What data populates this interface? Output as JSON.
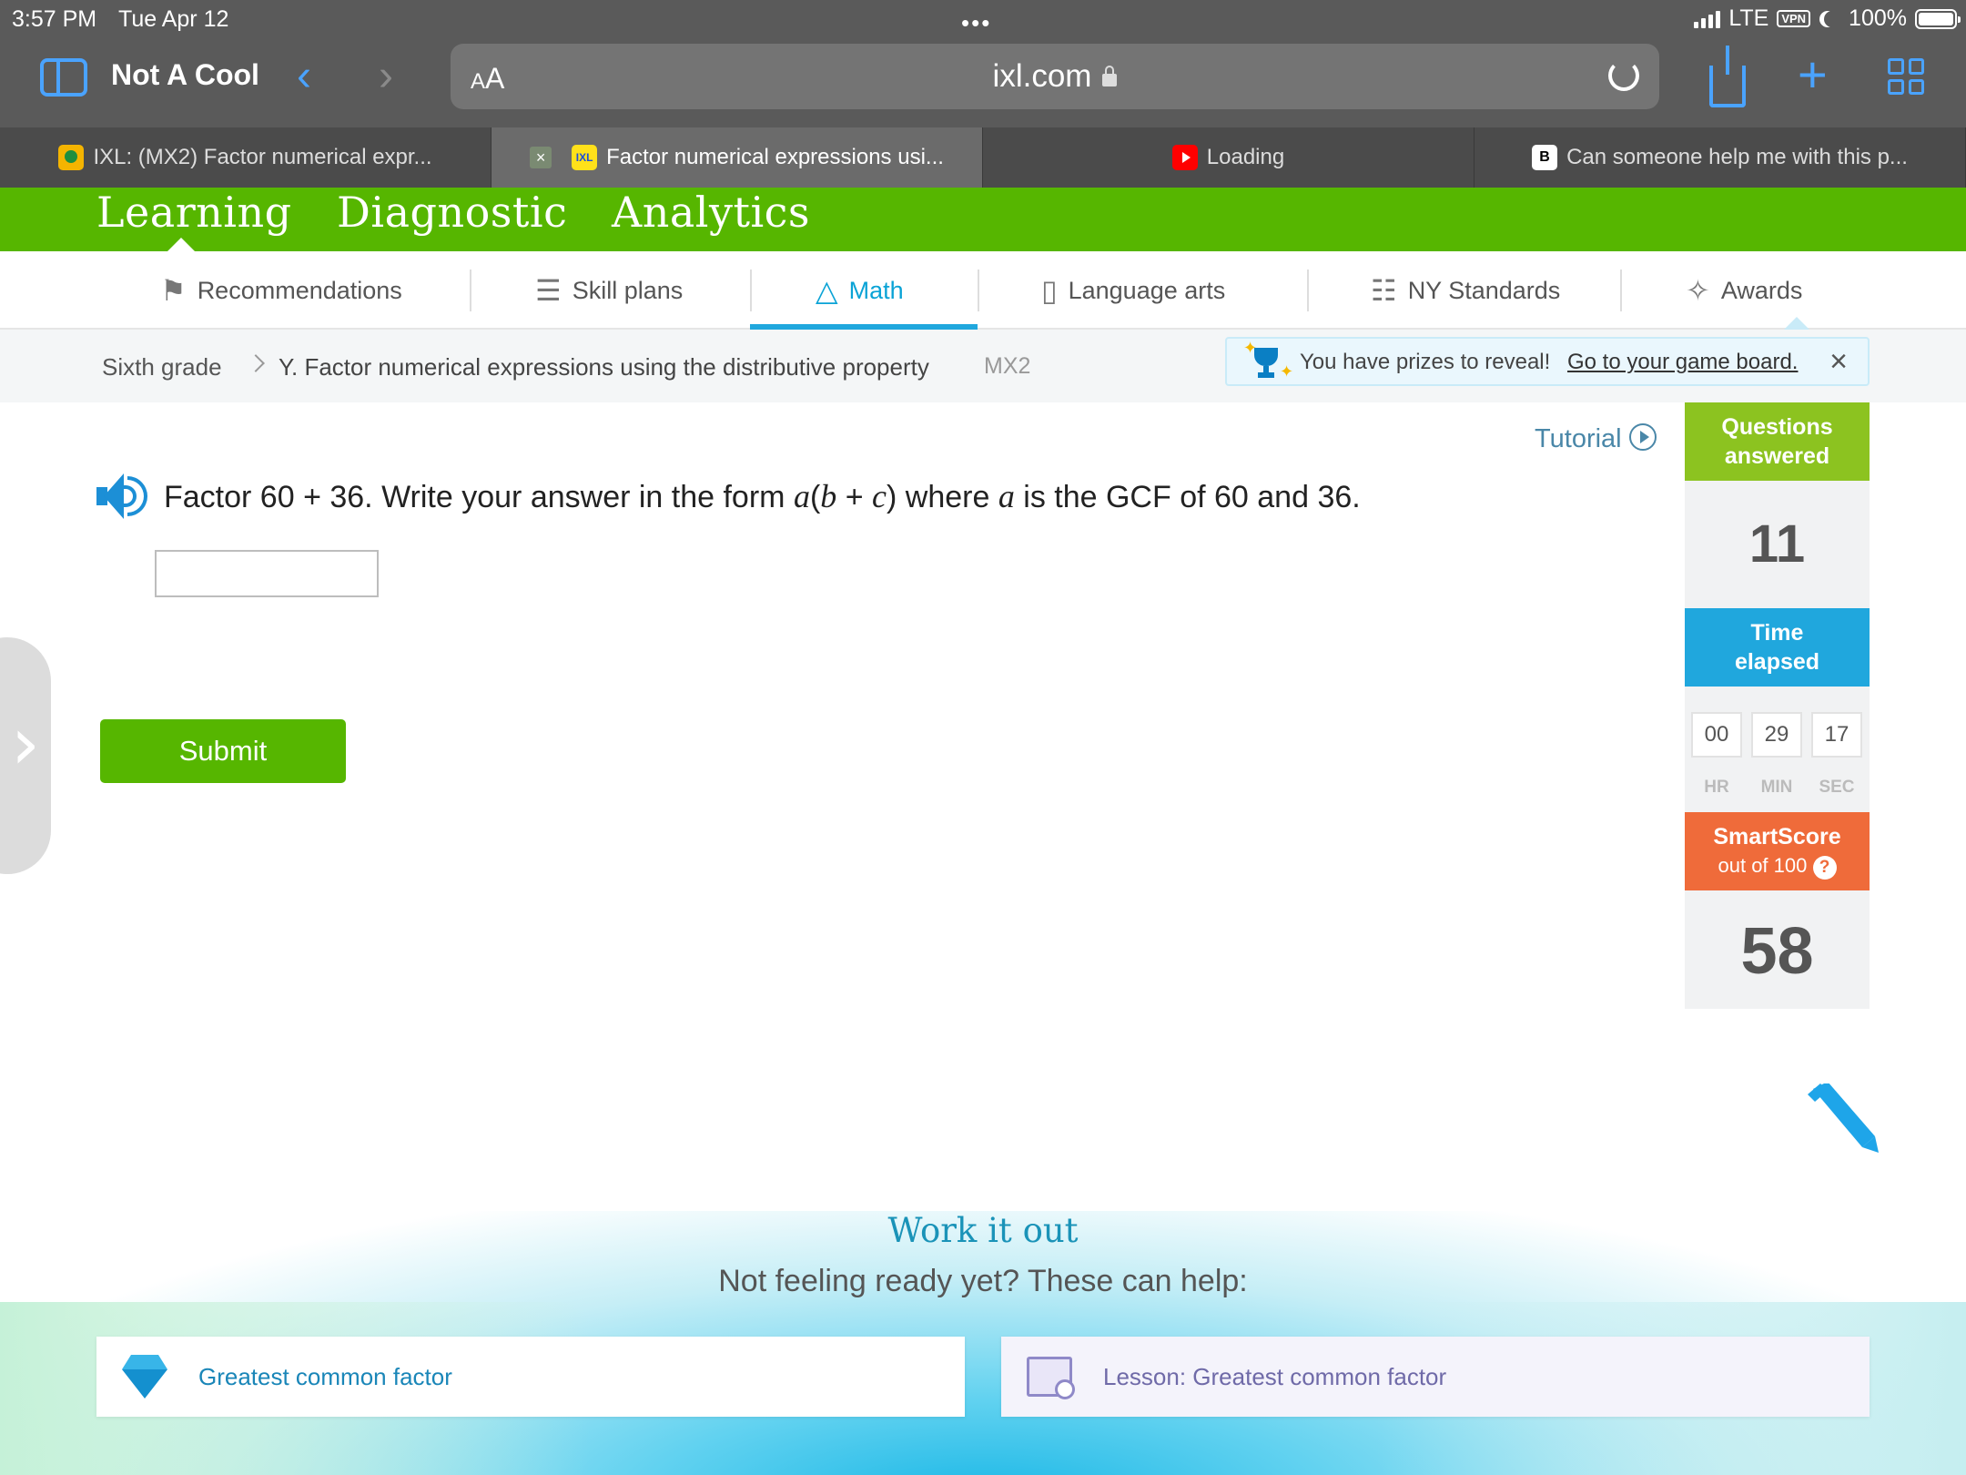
{
  "status": {
    "time": "3:57 PM",
    "date": "Tue Apr 12",
    "network": "LTE",
    "vpn": "VPN",
    "battery": "100%"
  },
  "browser": {
    "tab_group": "Not A Cool",
    "url_aa": "AA",
    "url": "ixl.com",
    "tabs": [
      {
        "title": "IXL: (MX2) Factor numerical expr...",
        "icon": "google-classroom-icon"
      },
      {
        "title": "Factor numerical expressions usi...",
        "icon": "ixl-icon",
        "active": true
      },
      {
        "title": "Loading",
        "icon": "youtube-icon"
      },
      {
        "title": "Can someone help me with this p...",
        "icon": "brainly-icon"
      }
    ]
  },
  "ixl_nav": {
    "tabs": [
      "Learning",
      "Diagnostic",
      "Analytics"
    ],
    "active": "Learning"
  },
  "subject_nav": {
    "items": [
      "Recommendations",
      "Skill plans",
      "Math",
      "Language arts",
      "NY Standards",
      "Awards"
    ],
    "active": "Math"
  },
  "breadcrumb": {
    "grade": "Sixth grade",
    "skill": "Y. Factor numerical expressions using the distributive property",
    "code": "MX2"
  },
  "prize": {
    "message": "You have prizes to reveal!",
    "link": "Go to your game board."
  },
  "tutorial_label": "Tutorial",
  "question": {
    "p1": "Factor 60 + 36. Write your answer in the form ",
    "a": "a",
    "p2": "(",
    "b": "b",
    "p3": " + ",
    "c": "c",
    "p4": ") where ",
    "a2": "a",
    "p5": " is the GCF of 60 and 36.",
    "answer_value": ""
  },
  "submit_label": "Submit",
  "stats": {
    "questions_answered_label": "Questions answered",
    "questions_answered": "11",
    "time_elapsed_label": "Time elapsed",
    "hr": "00",
    "min": "29",
    "sec": "17",
    "hr_label": "HR",
    "min_label": "MIN",
    "sec_label": "SEC",
    "smartscore_label": "SmartScore",
    "smartscore_sub": "out of 100",
    "smartscore_help": "?",
    "smartscore": "58"
  },
  "work_it_out": {
    "title": "Work it out",
    "subtitle": "Not feeling ready yet? These can help:",
    "skill_link": "Greatest common factor",
    "lesson_link": "Lesson: Greatest common factor"
  },
  "colors": {
    "ixl_green": "#56b600",
    "accent_blue": "#20a7dd",
    "smartscore_orange": "#ef6b3a",
    "answered_green": "#8cc320"
  }
}
